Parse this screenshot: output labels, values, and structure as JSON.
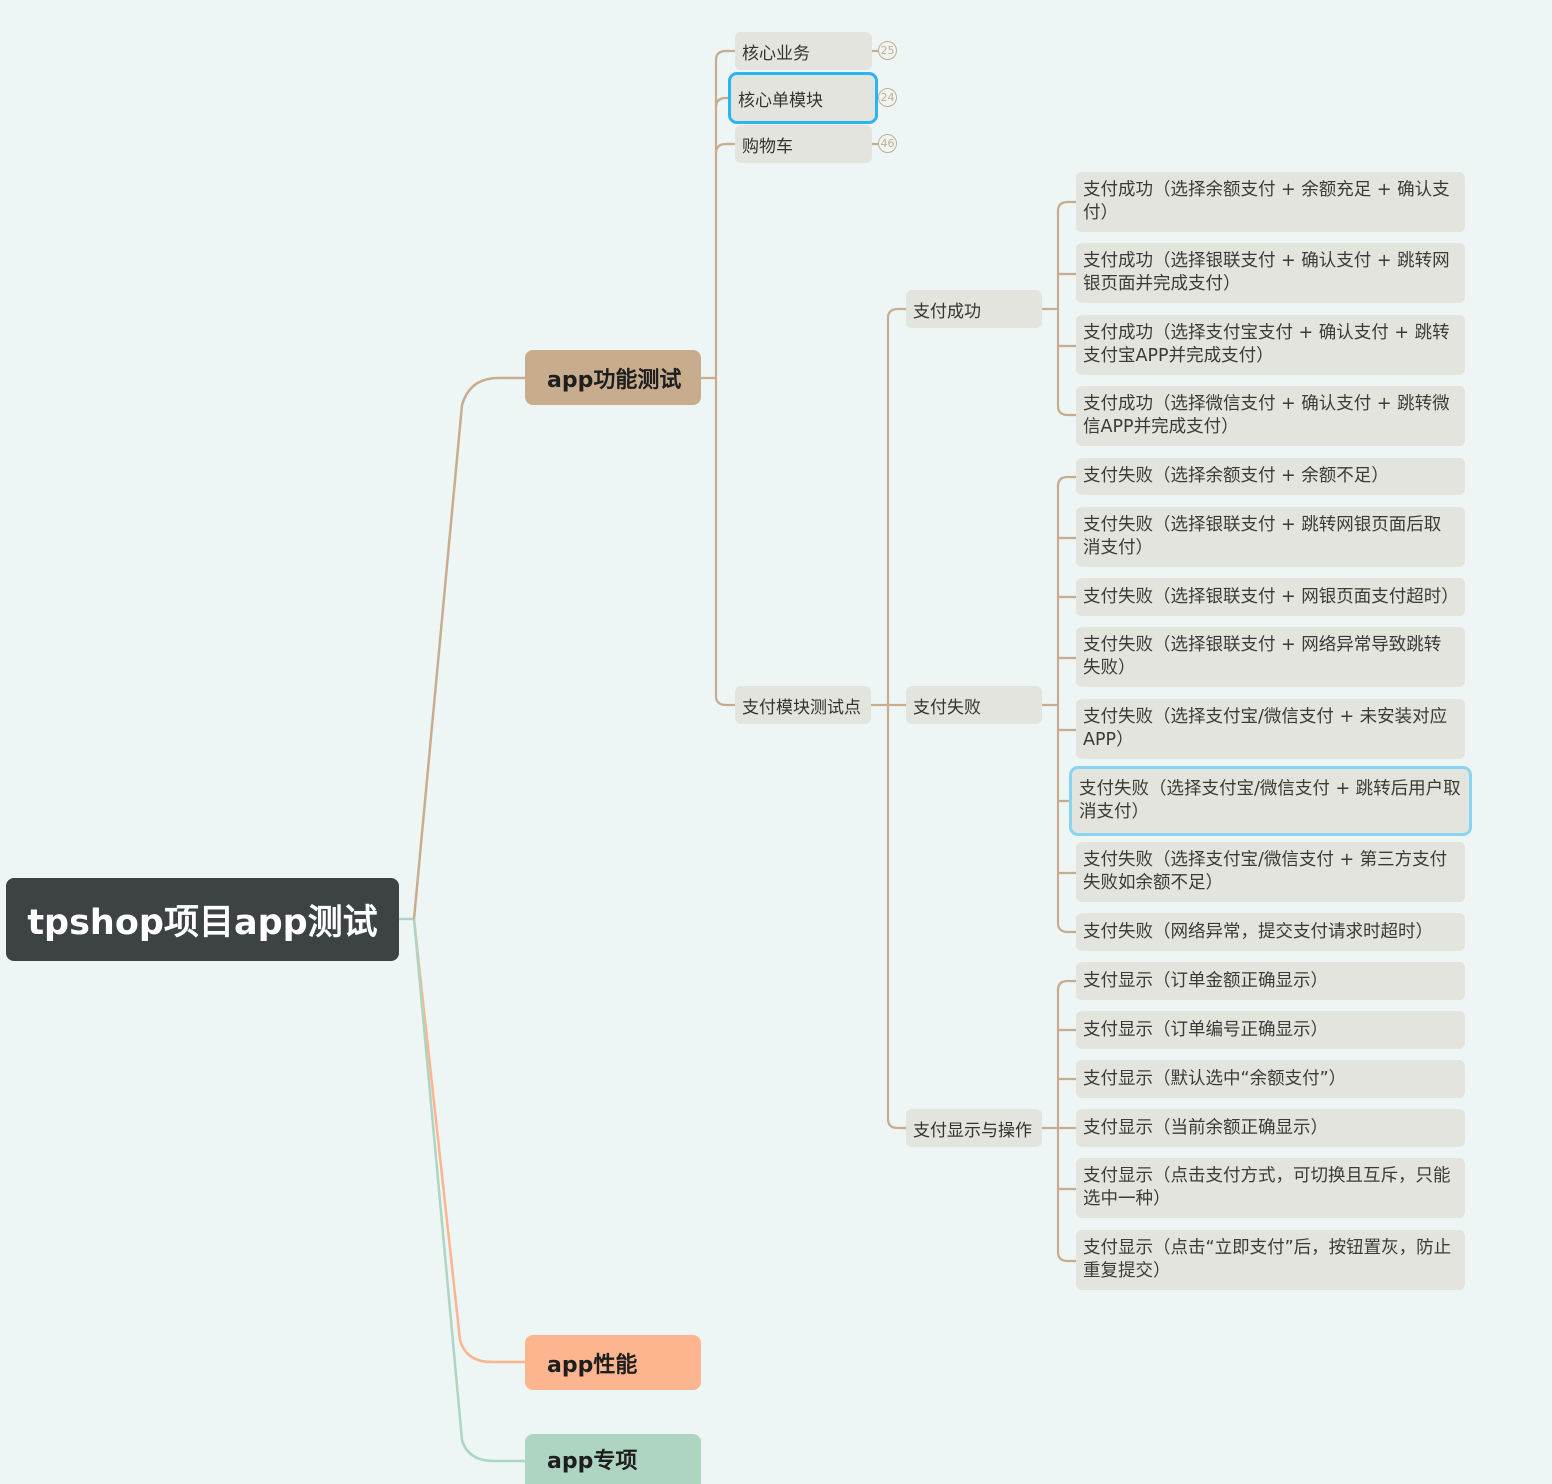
{
  "root": {
    "label": "tpshop项目app测试"
  },
  "branches": {
    "function": "app功能测试",
    "performance": "app性能",
    "special": "app专项"
  },
  "modules": [
    {
      "label": "核心业务",
      "count": "25"
    },
    {
      "label": "核心单模块",
      "count": "24"
    },
    {
      "label": "购物车",
      "count": "46"
    },
    {
      "label": "支付模块测试点"
    }
  ],
  "groups": {
    "success": "支付成功",
    "failure": "支付失败",
    "display": "支付显示与操作"
  },
  "leaves": {
    "success": [
      "支付成功（选择余额支付 + 余额充足 + 确认支付）",
      "支付成功（选择银联支付 + 确认支付 + 跳转网银页面并完成支付）",
      "支付成功（选择支付宝支付 + 确认支付 + 跳转支付宝APP并完成支付）",
      "支付成功（选择微信支付 + 确认支付 + 跳转微信APP并完成支付）"
    ],
    "failure": [
      "支付失败（选择余额支付 + 余额不足）",
      "支付失败（选择银联支付 + 跳转网银页面后取消支付）",
      "支付失败（选择银联支付 + 网银页面支付超时）",
      "支付失败（选择银联支付 + 网络异常导致跳转失败）",
      "支付失败（选择支付宝/微信支付 + 未安装对应APP）",
      "支付失败（选择支付宝/微信支付 + 跳转后用户取消支付）",
      "支付失败（选择支付宝/微信支付 + 第三方支付失败如余额不足）",
      "支付失败（网络异常，提交支付请求时超时）"
    ],
    "display": [
      "支付显示（订单金额正确显示）",
      "支付显示（订单编号正确显示）",
      "支付显示（默认选中“余额支付”）",
      "支付显示（当前余额正确显示）",
      "支付显示（点击支付方式，可切换且互斥，只能选中一种）",
      "支付显示（点击“立即支付”后，按钮置灰，防止重复提交）"
    ]
  },
  "colors": {
    "background": "#edf5f5",
    "root": "#3d4245",
    "function_branch": "#c7ad8d",
    "performance_branch": "#fcb58e",
    "special_branch": "#aed5c2",
    "node_fill": "#e4e4de",
    "selection": "#2ab4f2"
  }
}
